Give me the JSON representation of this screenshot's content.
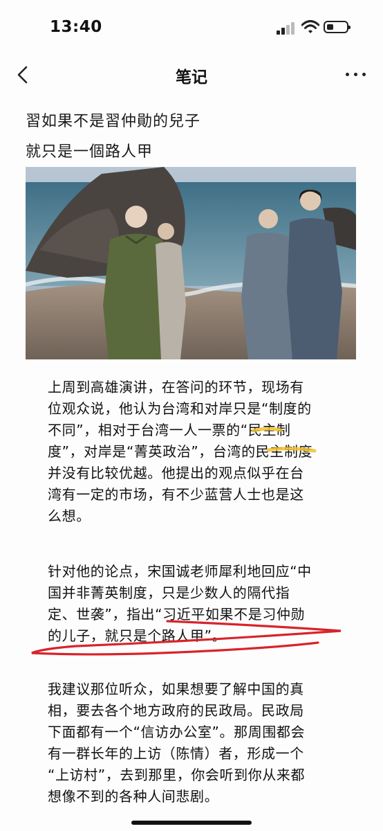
{
  "status_bar": {
    "time": "13:40"
  },
  "nav": {
    "title": "笔记"
  },
  "caption": {
    "line1": "習如果不是習仲勛的兒子",
    "line2": "就只是一個路人甲"
  },
  "photo": {
    "description_icon": "photo"
  },
  "paragraphs": [
    {
      "lines": [
        "上周到高雄演讲，在答问的环节，现场有",
        "位观众说，他认为台湾和对岸只是“制度的",
        "不同”，相对于台湾一人一票的“民主制",
        "度”，对岸是“菁英政治”，台湾的民主制度",
        "并没有比较优越。他提出的观点似乎在台",
        "湾有一定的市场，有不少蓝营人士也是这",
        "么想。"
      ]
    },
    {
      "lines": [
        "针对他的论点，宋国诚老师犀利地回应“中",
        "国并非菁英制度，只是少数人的隔代指",
        "定、世袭”，指出“习近平如果不是习仲勋",
        "的儿子，就只是个路人甲”。"
      ]
    },
    {
      "lines": [
        "我建议那位听众，如果想要了解中国的真",
        "相，要去各个地方政府的民政局。民政局",
        "下面都有一个“信访办公室”。那周围都会",
        "有一群长年的上访（陈情）者，形成一个",
        "“上访村”，去到那里，你会听到你从来都",
        "想像不到的各种人间悲剧。"
      ]
    }
  ],
  "colors": {
    "highlight": "#f2c12e",
    "underline": "#d8232a"
  }
}
